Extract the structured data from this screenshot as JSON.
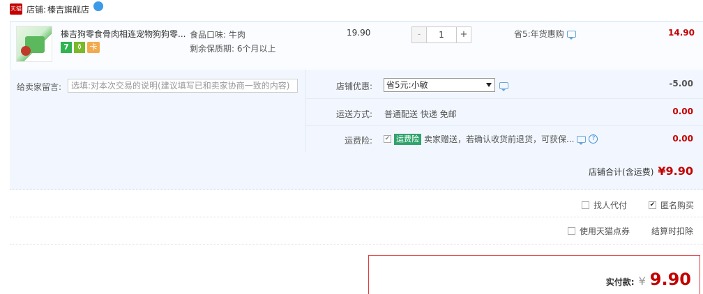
{
  "shop": {
    "logo_text": "天猫",
    "label": "店铺:",
    "name": "榛吉旗舰店"
  },
  "item": {
    "title": "榛吉狗零食骨肉相连宠物狗狗零...",
    "badges": [
      "7",
      "⚱",
      "卡"
    ],
    "sku_flavor": "食品口味: 牛肉",
    "sku_shelf": "剩余保质期: 6个月以上",
    "price": "19.90",
    "quantity": "1",
    "qty_minus": "-",
    "qty_plus": "+",
    "promo": "省5:年货惠购",
    "subtotal": "14.90"
  },
  "message": {
    "label": "给卖家留言:",
    "placeholder": "选填:对本次交易的说明(建议填写已和卖家协商一致的内容)"
  },
  "shop_discount": {
    "label": "店铺优惠:",
    "selected": "省5元:小敏",
    "amount": "-5.00"
  },
  "shipping": {
    "label": "运送方式:",
    "value": "普通配送 快递 免邮",
    "amount": "0.00"
  },
  "insurance": {
    "label": "运费险:",
    "checked": "✔",
    "tag": "运费险",
    "text": "卖家赠送，若确认收货前退货，可获保...",
    "help": "?",
    "amount": "0.00"
  },
  "shop_total": {
    "label": "店铺合计(含运费)",
    "amount": "¥9.90"
  },
  "options": {
    "find_pay": "找人代付",
    "anonymous": "匿名购买",
    "anonymous_check": "✔",
    "tmall_points": "使用天猫点券",
    "settle_note": "结算时扣除"
  },
  "payment": {
    "label": "实付款:",
    "currency": "¥",
    "amount": "9.90"
  }
}
